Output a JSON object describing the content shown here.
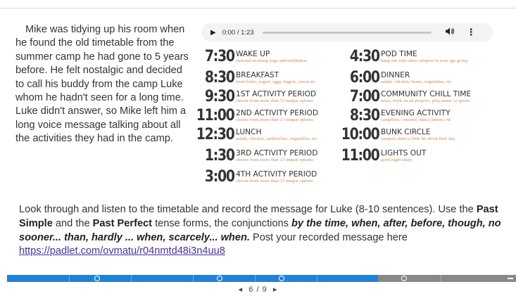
{
  "story": {
    "text": "Mike was tidying up his room when he found the old timetable from the summer camp he had gone to 5 years before. He felt nostalgic and decided to call his buddy from the camp Luke whom he hadn't seen for a long time. Luke didn't answer, so Mike left him a long voice message talking about all the activities they had in the camp."
  },
  "audio_player": {
    "play_icon": "play-icon",
    "current_time": "0:00 / 1:23",
    "progress": 0,
    "volume_icon": "volume-icon",
    "more_icon": "more-vertical-icon"
  },
  "timetable": {
    "left": [
      {
        "time": "7:30",
        "activity": "WAKE UP",
        "note": "optional morning yoga and meditation"
      },
      {
        "time": "8:30",
        "activity": "BREAKFAST",
        "note": "fresh fruits, yogurt, eggs, bagels, cereal etc"
      },
      {
        "time": "9:30",
        "activity": "1ST ACTIVITY PERIOD",
        "note": "choose from more than 13 unique options"
      },
      {
        "time": "11:00",
        "activity": "2ND ACTIVITY PERIOD",
        "note": "choose from more than 13 unique options"
      },
      {
        "time": "12:30",
        "activity": "LUNCH",
        "note": "salads, chicken, sandwiches, vegetables, etc"
      },
      {
        "time": "1:30",
        "activity": "3RD ACTIVITY PERIOD",
        "note": "choose from more than 13 unique options"
      },
      {
        "time": "3:00",
        "activity": "4TH ACTIVITY PERIOD",
        "note": "choose from more than 13 unique options"
      }
    ],
    "right": [
      {
        "time": "4:30",
        "activity": "POD TIME",
        "note": "hang out with other campers in your age group"
      },
      {
        "time": "6:00",
        "activity": "DINNER",
        "note": "salads, chicken, beans, vegetables, etc"
      },
      {
        "time": "7:00",
        "activity": "COMMUNITY CHILL TIME",
        "note": "relax, work on art projects, play music or sports"
      },
      {
        "time": "8:30",
        "activity": "EVENING ACTIVITY",
        "note": "campfires, concerts, dance parties, etc"
      },
      {
        "time": "10:00",
        "activity": "BUNK CIRCLE",
        "note": "campers share a little bit about their day"
      },
      {
        "time": "11:00",
        "activity": "LIGHTS OUT",
        "note": "good night sleep"
      }
    ]
  },
  "instructions": {
    "part1": "Look through and listen to the timetable and record the message for Luke (8-10 sentences). Use the ",
    "past_simple": "Past Simple",
    "and": " and the ",
    "past_perfect": "Past Perfect",
    "part2": " tense forms, the conjunctions ",
    "conjunctions": "by the time, when, after, before, though, no sooner... than, hardly ... when, scarcely... when.",
    "part3": " Post your recorded message here ",
    "link": "https://padlet.com/ovmatu/r04nmtd48i3n4uu8"
  },
  "navigation": {
    "prev_label": "◂",
    "page_indicator": "6 / 9",
    "next_label": "▸",
    "current_page": 6,
    "total_pages": 9
  },
  "colors": {
    "progress_filled": "#1f82d6",
    "progress_empty": "#888888",
    "note_text": "#d4875a",
    "link": "#4a2f9c"
  }
}
